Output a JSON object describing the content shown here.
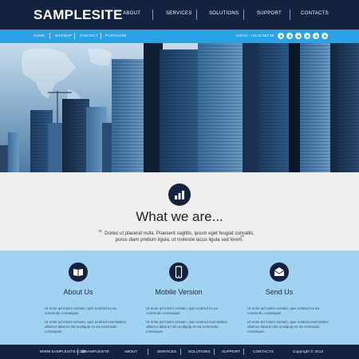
{
  "header": {
    "logo": "SAMPLESITE",
    "nav": [
      "ABOUT",
      "SERVICES",
      "SOLUTIONS",
      "SUPPORT",
      "CONTACTS"
    ]
  },
  "subbar": {
    "nav": [
      "HOME",
      "SITEMAP",
      "CONTACT",
      "PURCHASE"
    ],
    "callus": "Call Us : +12 34 567 89",
    "social_icons": [
      "twitter-icon",
      "facebook-icon",
      "linkedin-icon",
      "rss-icon",
      "skype-icon",
      "mail-icon"
    ]
  },
  "what": {
    "title": "What we are...",
    "quote_line1": "Donec ut placerat nulla. Praesent sagittis, ipsum eget feugiat convallis,",
    "quote_line2": "purus diam pretium ligula, ut molestie lacus ligula sed lorem."
  },
  "features": [
    {
      "title": "About Us",
      "icon": "book-icon",
      "para1": "Ut enim ad minim veniam, quis nostrud ex ea commodo consequat.",
      "para2": "Ut enim ad minim veniam, quis nostrud exercitation ullamco laboris nisi ut aliquip ex ea commodo consequat."
    },
    {
      "title": "Mobile Version",
      "icon": "mobile-icon",
      "para1": "Ut enim ad minim veniam, quis nostrud ex ea commodo consequat.",
      "para2": "Ut enim ad minim veniam, quis nostrud exercitation ullamco laboris nisi ut aliquip ex ea commodo consequat."
    },
    {
      "title": "Send Us",
      "icon": "envelope-icon",
      "para1": "Ut enim ad minim veniam, quis nostrud ex ea commodo consequat.",
      "para2": "Ut enim ad minim veniam, quis nostrud exercitation ullamco laboris nisi ut aliquip ex ea commodo consequat."
    }
  ],
  "footer": {
    "site": "WWW.SAMPLESITE.COM",
    "handle": "@SAMPLESITE",
    "nav": [
      "ABOUT",
      "SERVICES",
      "SOLUTIONS",
      "SUPPORT",
      "CONTACTS"
    ],
    "copyright": "Copyright © 2013"
  },
  "colors": {
    "dark_navy": "#12223f",
    "accent_blue": "#29a3e6",
    "light_blue": "#9fd3f1",
    "light_gray": "#efefef"
  }
}
